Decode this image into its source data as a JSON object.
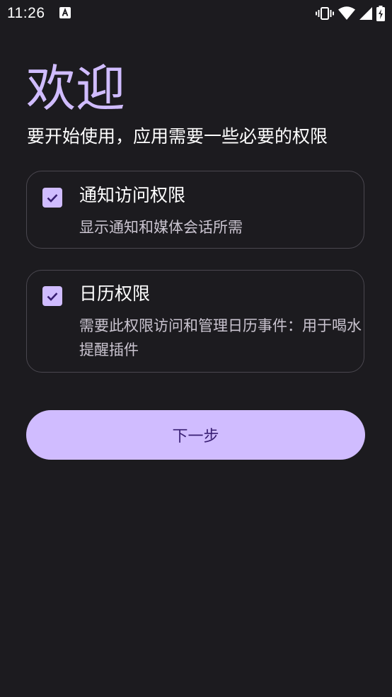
{
  "status_bar": {
    "time": "11:26"
  },
  "welcome": {
    "title": "欢迎",
    "subtitle": "要开始使用，应用需要一些必要的权限"
  },
  "permissions": [
    {
      "title": "通知访问权限",
      "description": "显示通知和媒体会话所需",
      "checked": true
    },
    {
      "title": "日历权限",
      "description": "需要此权限访问和管理日历事件：用于喝水提醒插件",
      "checked": true
    }
  ],
  "next_button": {
    "label": "下一步"
  },
  "colors": {
    "background": "#1c1b1f",
    "accent": "#d0bcff",
    "on_accent": "#381e72",
    "card_border": "#4a474f",
    "secondary_text": "#cac4d0"
  }
}
